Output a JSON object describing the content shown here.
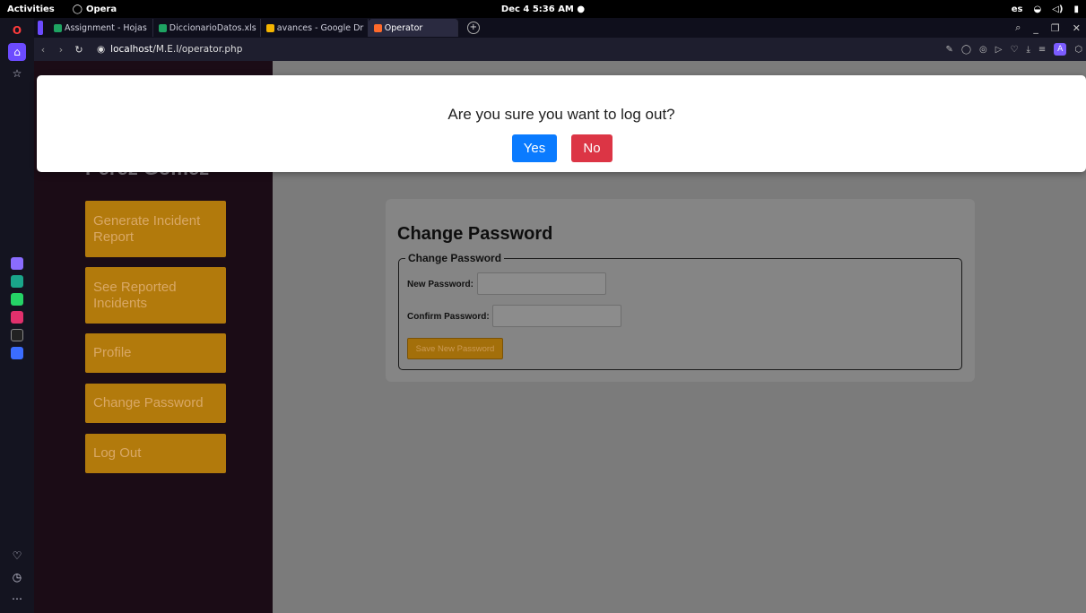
{
  "os_topbar": {
    "activities": "Activities",
    "app_name": "Opera",
    "clock": "Dec 4  5:36 AM  ●",
    "tray": {
      "lang": "es",
      "wifi": "◒",
      "sound": "◁)",
      "battery": "▮"
    }
  },
  "browser": {
    "tabs": [
      {
        "label": "Assignment - Hojas",
        "icon_color": "#1ea362"
      },
      {
        "label": "DiccionarioDatos.xls",
        "icon_color": "#1ea362"
      },
      {
        "label": "avances - Google Dr",
        "icon_color": "#f4b400"
      },
      {
        "label": "Operator",
        "icon_color": "#ff6a2b",
        "active": true
      }
    ],
    "new_tab": "+",
    "window_controls": {
      "search": "⌕",
      "minimize": "_",
      "restore": "❐",
      "close": "✕"
    },
    "url_host": "localhost",
    "url_path": "/M.E.I/operator.php",
    "profile_initial": "A"
  },
  "app": {
    "user_name": "Perez Gómez",
    "menu": [
      "Generate Incident Report",
      "See Reported Incidents",
      "Profile",
      "Change Password",
      "Log Out"
    ],
    "change_password": {
      "title": "Change Password",
      "legend": "Change Password",
      "new_label": "New Password:",
      "confirm_label": "Confirm Password:",
      "save_label": "Save New Password"
    }
  },
  "modal": {
    "message": "Are you sure you want to log out?",
    "yes_label": "Yes",
    "no_label": "No"
  },
  "colors": {
    "menu_button": "#b27a0c",
    "yes_button": "#0a7bff",
    "no_button": "#dc3545",
    "app_sidebar": "#1b0c16"
  }
}
